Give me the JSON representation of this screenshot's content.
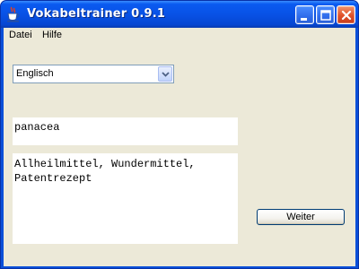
{
  "window": {
    "title": "Vokabeltrainer 0.9.1",
    "icon": "java-cup-icon",
    "controls": [
      "minimize",
      "maximize",
      "close"
    ]
  },
  "menubar": {
    "items": [
      {
        "label": "Datei"
      },
      {
        "label": "Hilfe"
      }
    ]
  },
  "language_select": {
    "value": "Englisch",
    "arrow_icon": "chevron-down-icon"
  },
  "word": {
    "text": "panacea"
  },
  "translation": {
    "text": "Allheilmittel, Wundermittel,\nPatentrezept"
  },
  "actions": {
    "next_label": "Weiter"
  },
  "colors": {
    "titlebar": "#0852E6",
    "window_bg": "#ECE9D8",
    "close_button": "#E0512A",
    "field_border": "#7F9DB9"
  }
}
